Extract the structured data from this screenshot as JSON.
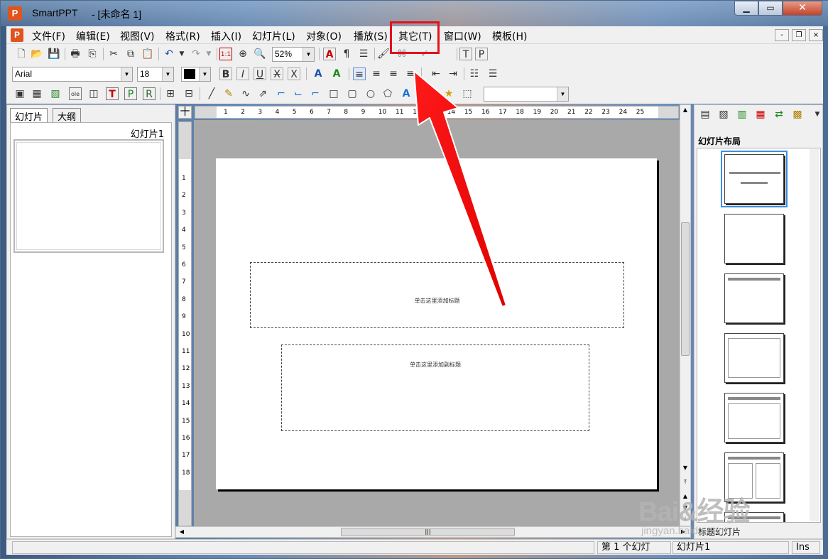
{
  "window": {
    "app_name": "SmartPPT",
    "document_title": "- [未命名 1]",
    "app_icon_letter": "P",
    "minimize": "▁",
    "maximize": "▭",
    "close": "✕"
  },
  "menu": {
    "items": [
      "文件(F)",
      "编辑(E)",
      "视图(V)",
      "格式(R)",
      "插入(I)",
      "幻灯片(L)",
      "对象(O)",
      "播放(S)",
      "其它(T)",
      "窗口(W)",
      "模板(H)"
    ],
    "highlighted": "其它(T)",
    "highlight_color": "#e3121e",
    "mdi_min": "-",
    "mdi_restore": "❐",
    "mdi_close": "×"
  },
  "toolbar1": {
    "zoom_value": "52%"
  },
  "toolbar2": {
    "font_name": "Arial",
    "font_size": "18",
    "font_color": "#000000"
  },
  "toolbar3": {
    "shape_select_value": ""
  },
  "left_panel": {
    "tabs": [
      "幻灯片",
      "大纲"
    ],
    "active_tab": "幻灯片",
    "slide_label": "幻灯片1"
  },
  "ruler": {
    "corner_symbol": "十",
    "h_numbers": [
      "1",
      "2",
      "3",
      "4",
      "5",
      "6",
      "7",
      "8",
      "9",
      "10",
      "11",
      "12",
      "13",
      "14",
      "15",
      "16",
      "17",
      "18",
      "19",
      "20",
      "21",
      "22",
      "23",
      "24",
      "25"
    ],
    "v_numbers": [
      "1",
      "2",
      "3",
      "4",
      "5",
      "6",
      "7",
      "8",
      "9",
      "10",
      "11",
      "12",
      "13",
      "14",
      "15",
      "16",
      "17",
      "18"
    ]
  },
  "slide": {
    "title_placeholder": "单击这里添加标题",
    "subtitle_placeholder": "单击这里添加副标题"
  },
  "right_panel": {
    "header": "幻灯片布局",
    "footer_label": "标题幻灯片"
  },
  "statusbar": {
    "slide_count": "第 1 个幻灯",
    "slide_name": "幻灯片1",
    "mode": "Ins"
  },
  "watermark": {
    "logo": "Bai&经验",
    "url": "jingyan.baidu.com"
  }
}
